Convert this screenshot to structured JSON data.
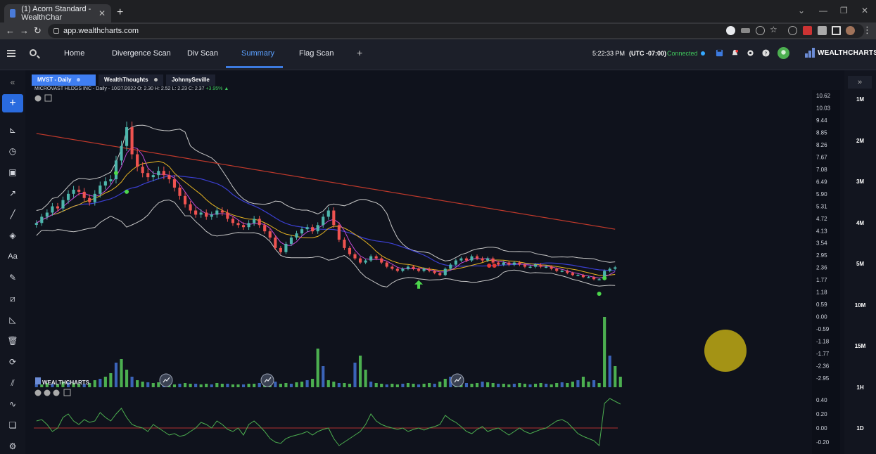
{
  "browser": {
    "tab_title": "(1) Acorn Standard - WealthChar",
    "tab_close": "✕",
    "new_tab": "+",
    "url": "app.wealthcharts.com",
    "controls": {
      "minimize": "—",
      "restore": "❐",
      "close": "✕",
      "down": "⌄"
    }
  },
  "header": {
    "tabs": [
      {
        "label": "Home"
      },
      {
        "label": "Divergence Scan"
      },
      {
        "label": "Div Scan"
      },
      {
        "label": "Summary",
        "active": true
      },
      {
        "label": "Flag Scan"
      }
    ],
    "add_tab": "+",
    "time": "5:22:33 PM",
    "timezone": "(UTC -07:00)",
    "connection_status": "Connected",
    "logo_text": "WEALTHCHARTS",
    "colors": {
      "accent": "#3d7be0",
      "connected": "#3fc75c"
    }
  },
  "left_toolbar": {
    "collapse": "«",
    "add": "+",
    "items": [
      "indicators-icon",
      "clock-icon",
      "calendar-icon",
      "trend-line-icon",
      "line-icon",
      "shapes-icon",
      "text-icon",
      "pencil-icon",
      "ruler-icon",
      "measure-icon",
      "trash-icon",
      "refresh-icon",
      "chart-icon",
      "draw-icon",
      "layers-icon",
      "settings-icon"
    ],
    "text_tool": "Aa"
  },
  "right_panel": {
    "collapse": "»",
    "timeframes": [
      "1M",
      "2M",
      "3M",
      "4M",
      "5M",
      "10M",
      "15M",
      "1H",
      "1D"
    ]
  },
  "chart_tabs": [
    {
      "label": "MVST - Daily",
      "active": true
    },
    {
      "label": "WealthThoughts"
    },
    {
      "label": "JohnnySeville"
    }
  ],
  "symbol_info": {
    "name": "MICROVAST HLDGS INC",
    "interval": "Daily",
    "date": "10/27/2022",
    "open": "O: 2.30",
    "high": "H: 2.52",
    "low": "L: 2.23",
    "close": "C: 2.37",
    "change": "+3.95%"
  },
  "chart_data": {
    "type": "line",
    "description_of_panes": [
      "price (candles, moving averages, Bollinger Bands)",
      "volume",
      "oscillator"
    ],
    "price_axis_ticks": [
      "10.62",
      "10.03",
      "9.44",
      "8.85",
      "8.26",
      "7.67",
      "7.08",
      "6.49",
      "5.90",
      "5.31",
      "4.72",
      "4.13",
      "3.54",
      "2.95",
      "2.36",
      "1.77",
      "1.18",
      "0.59",
      "0.00",
      "-0.59",
      "-1.18",
      "-1.77",
      "-2.36",
      "-2.95"
    ],
    "oscillator_axis_ticks": [
      "0.40",
      "0.20",
      "0.00",
      "-0.20"
    ],
    "ylim": [
      -2.95,
      10.62
    ],
    "close_approx": [
      4.5,
      4.8,
      5.0,
      5.3,
      5.2,
      5.6,
      5.9,
      6.1,
      6.0,
      5.7,
      5.5,
      5.9,
      6.3,
      6.5,
      6.6,
      7.5,
      8.2,
      9.1,
      7.8,
      7.2,
      6.9,
      6.7,
      6.8,
      7.0,
      6.8,
      6.6,
      6.2,
      5.8,
      5.4,
      5.1,
      4.9,
      5.0,
      4.8,
      4.9,
      5.1,
      5.0,
      4.7,
      4.5,
      4.4,
      4.3,
      4.5,
      4.7,
      4.4,
      4.1,
      3.8,
      3.3,
      3.1,
      3.5,
      3.8,
      4.0,
      4.2,
      4.3,
      4.1,
      4.4,
      4.8,
      5.1,
      4.4,
      3.7,
      3.3,
      3.0,
      2.8,
      2.6,
      2.7,
      2.9,
      2.8,
      2.6,
      2.4,
      2.3,
      2.2,
      2.3,
      2.4,
      2.3,
      2.2,
      2.3,
      2.2,
      2.1,
      2.0,
      2.3,
      2.5,
      2.7,
      2.8,
      2.7,
      2.9,
      2.8,
      2.7,
      2.8,
      2.6,
      2.5,
      2.6,
      2.5,
      2.6,
      2.5,
      2.4,
      2.4,
      2.5,
      2.4,
      2.4,
      2.3,
      2.2,
      2.2,
      2.1,
      2.0,
      2.0,
      1.9,
      1.9,
      1.8,
      1.8,
      2.2,
      2.3,
      2.37
    ],
    "ma_long": {
      "start": 8.8,
      "end": 4.2
    },
    "volume_relative": [
      0.05,
      0.04,
      0.06,
      0.05,
      0.04,
      0.08,
      0.07,
      0.06,
      0.05,
      0.05,
      0.06,
      0.1,
      0.12,
      0.15,
      0.2,
      0.35,
      0.4,
      0.25,
      0.15,
      0.1,
      0.08,
      0.07,
      0.06,
      0.07,
      0.05,
      0.04,
      0.04,
      0.05,
      0.06,
      0.05,
      0.05,
      0.04,
      0.05,
      0.04,
      0.06,
      0.05,
      0.05,
      0.04,
      0.04,
      0.04,
      0.05,
      0.05,
      0.06,
      0.08,
      0.07,
      0.08,
      0.05,
      0.06,
      0.05,
      0.07,
      0.08,
      0.1,
      0.12,
      0.55,
      0.3,
      0.1,
      0.08,
      0.06,
      0.06,
      0.05,
      0.35,
      0.45,
      0.25,
      0.08,
      0.06,
      0.05,
      0.04,
      0.05,
      0.04,
      0.05,
      0.06,
      0.05,
      0.04,
      0.05,
      0.06,
      0.05,
      0.08,
      0.12,
      0.15,
      0.1,
      0.08,
      0.06,
      0.05,
      0.06,
      0.08,
      0.07,
      0.06,
      0.05,
      0.05,
      0.04,
      0.05,
      0.06,
      0.05,
      0.04,
      0.05,
      0.06,
      0.05,
      0.04,
      0.06,
      0.07,
      0.06,
      0.08,
      0.1,
      0.15,
      0.08,
      0.1,
      0.06,
      1.0,
      0.45,
      0.3,
      0.15
    ],
    "oscillator": [
      0.1,
      0.12,
      0.05,
      -0.05,
      0.0,
      0.15,
      0.2,
      0.1,
      0.05,
      0.12,
      0.08,
      0.1,
      0.22,
      0.15,
      0.1,
      0.2,
      0.28,
      0.15,
      0.05,
      0.02,
      0.0,
      -0.05,
      0.05,
      0.0,
      -0.05,
      -0.1,
      -0.08,
      -0.12,
      -0.1,
      -0.05,
      0.0,
      0.08,
      0.05,
      0.0,
      0.1,
      0.05,
      -0.02,
      -0.05,
      0.0,
      -0.1,
      0.05,
      0.1,
      0.03,
      -0.05,
      -0.15,
      -0.2,
      -0.22,
      -0.15,
      -0.12,
      -0.1,
      -0.08,
      -0.05,
      -0.1,
      -0.05,
      -0.02,
      0.0,
      -0.15,
      -0.25,
      -0.2,
      -0.15,
      -0.1,
      -0.05,
      0.05,
      0.2,
      0.1,
      0.05,
      0.02,
      0.0,
      -0.02,
      0.0,
      -0.05,
      -0.02,
      0.0,
      -0.03,
      0.0,
      0.02,
      0.05,
      0.18,
      0.12,
      0.08,
      0.02,
      -0.05,
      -0.08,
      -0.02,
      0.02,
      -0.05,
      -0.02,
      0.0,
      -0.05,
      -0.1,
      -0.05,
      0.0,
      -0.05,
      -0.08,
      -0.05,
      -0.02,
      0.0,
      0.05,
      0.1,
      0.12,
      0.08,
      0.0,
      -0.08,
      -0.12,
      -0.15,
      -0.18,
      -0.25,
      0.35,
      0.42,
      0.38,
      0.34
    ],
    "colors": {
      "up": "#4db6ac",
      "down": "#ef5350",
      "ma_long": "#c0392b",
      "ma_mid": "#e6b422",
      "ma_fast": "#c04ad6",
      "ma_slow": "#3b3fd1",
      "bands": "#c8c8c8",
      "volume": "#4caf50",
      "oscillator": "#4caf50",
      "zero_line": "#b03030"
    },
    "watermark": "WEALTHCHARTS"
  }
}
